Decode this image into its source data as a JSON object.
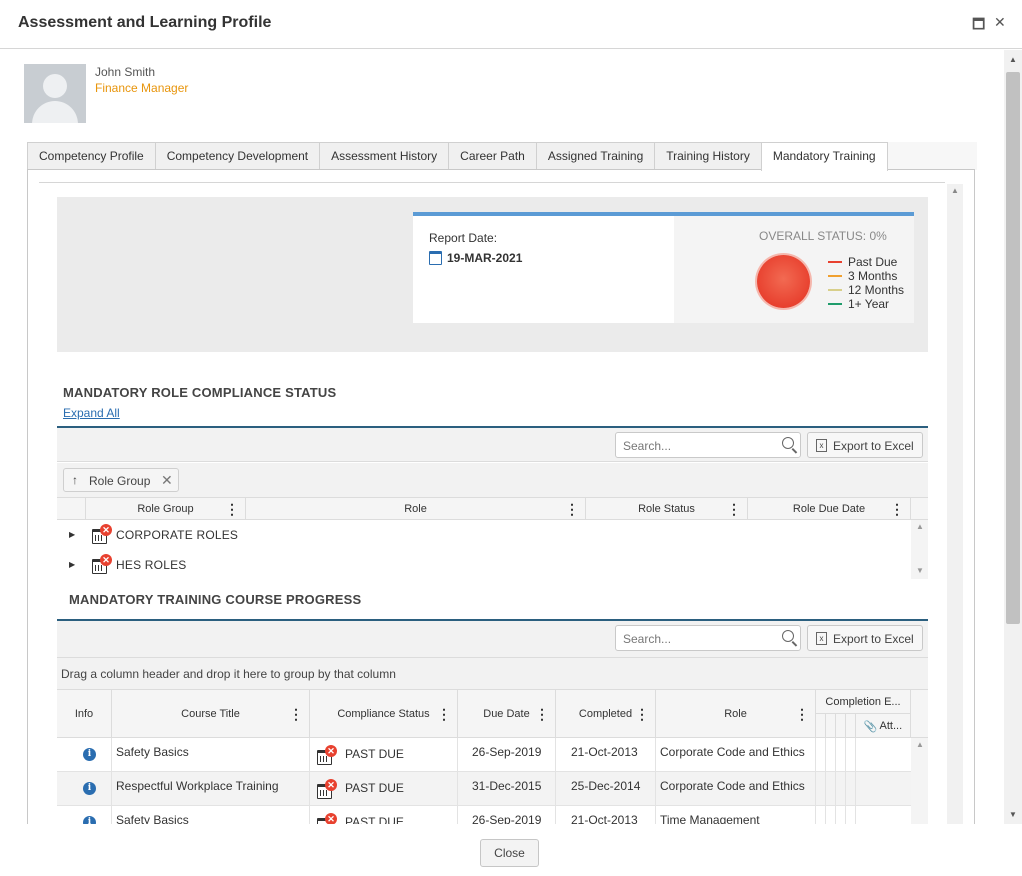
{
  "window": {
    "title": "Assessment and Learning Profile",
    "maximize_glyph": "🗖",
    "close_glyph": "✕"
  },
  "user": {
    "name": "John Smith",
    "role": "Finance Manager"
  },
  "tabs": [
    {
      "label": "Competency Profile"
    },
    {
      "label": "Competency Development"
    },
    {
      "label": "Assessment History"
    },
    {
      "label": "Career Path"
    },
    {
      "label": "Assigned Training"
    },
    {
      "label": "Training History"
    },
    {
      "label": "Mandatory Training",
      "active": true
    }
  ],
  "report": {
    "date_label": "Report Date:",
    "date_value": "19-MAR-2021",
    "overall_status": "OVERALL STATUS: 0%",
    "legend": [
      {
        "label": "Past Due",
        "color": "#e8412f"
      },
      {
        "label": "3 Months",
        "color": "#f0a030"
      },
      {
        "label": "12 Months",
        "color": "#d8cf8a"
      },
      {
        "label": "1+ Year",
        "color": "#1f9c6b"
      }
    ]
  },
  "role_compliance": {
    "title": "MANDATORY ROLE COMPLIANCE STATUS",
    "expand_all": "Expand All",
    "search_placeholder": "Search...",
    "export_label": "Export to Excel",
    "group_chip": "Role Group",
    "columns": [
      "Role Group",
      "Role",
      "Role Status",
      "Role Due Date"
    ],
    "groups": [
      "CORPORATE ROLES",
      "HES ROLES"
    ]
  },
  "course_progress": {
    "title": "MANDATORY TRAINING COURSE PROGRESS",
    "search_placeholder": "Search...",
    "export_label": "Export to Excel",
    "drag_hint": "Drag a column header and drop it here to group by that column",
    "columns": {
      "info": "Info",
      "course_title": "Course Title",
      "compliance_status": "Compliance Status",
      "due_date": "Due Date",
      "completed": "Completed",
      "role": "Role",
      "completion": "Completion E...",
      "attachments": "Att..."
    },
    "rows": [
      {
        "title": "Safety Basics",
        "status": "PAST DUE",
        "due": "26-Sep-2019",
        "completed": "21-Oct-2013",
        "role": "Corporate Code and Ethics"
      },
      {
        "title": "Respectful Workplace Training",
        "status": "PAST DUE",
        "due": "31-Dec-2015",
        "completed": "25-Dec-2014",
        "role": "Corporate Code and Ethics"
      },
      {
        "title": "Safety Basics",
        "status": "PAST DUE",
        "due": "26-Sep-2019",
        "completed": "21-Oct-2013",
        "role": "Time Management"
      }
    ]
  },
  "footer": {
    "close_label": "Close"
  }
}
